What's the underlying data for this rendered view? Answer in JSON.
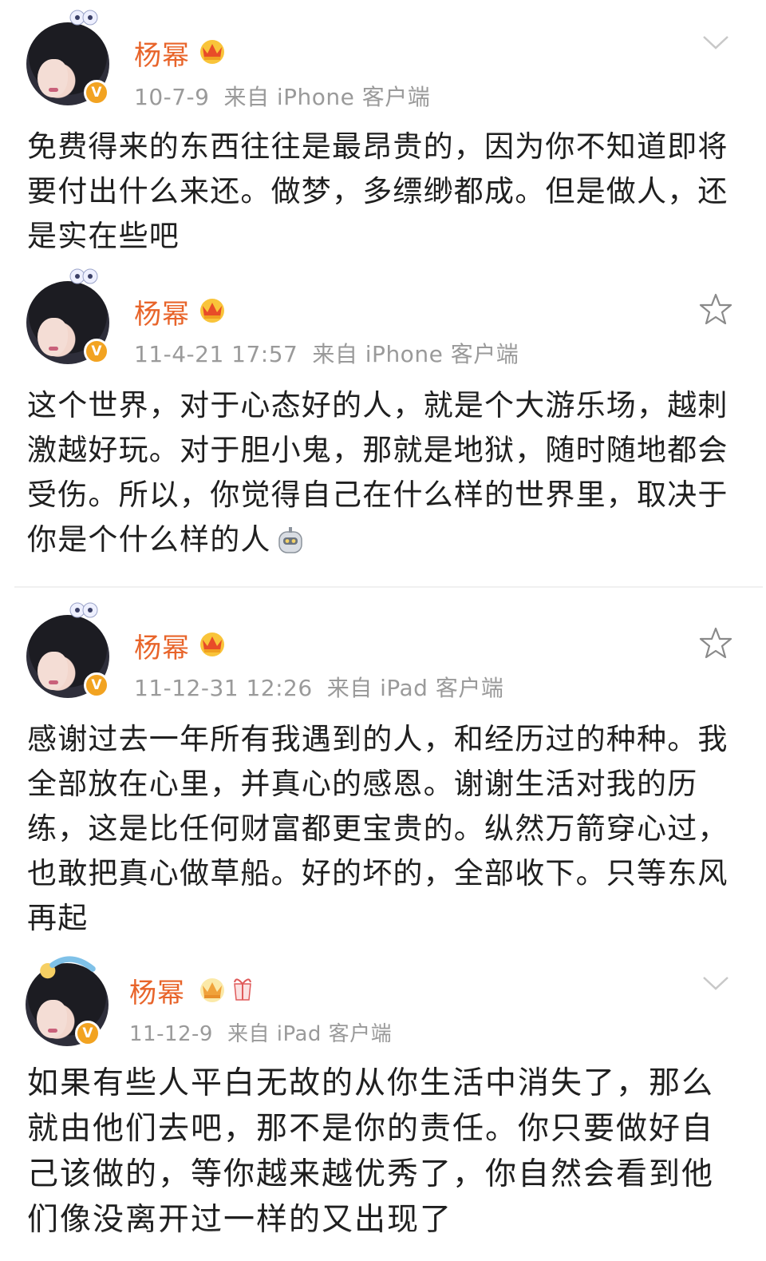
{
  "posts": [
    {
      "author": "杨幂",
      "time": "10-7-9",
      "source": "来自 iPhone 客户端",
      "text": "免费得来的东西往往是最昂贵的，因为你不知道即将要付出什么来还。做梦，多缥缈都成。但是做人，还是实在些吧",
      "action_icon": "chevron-down-icon"
    },
    {
      "author": "杨幂",
      "time": "11-4-21 17:57",
      "source": "来自 iPhone 客户端",
      "text": "这个世界，对于心态好的人，就是个大游乐场，越刺激越好玩。对于胆小鬼，那就是地狱，随时随地都会受伤。所以，你觉得自己在什么样的世界里，取决于你是个什么样的人",
      "action_icon": "star-icon"
    },
    {
      "author": "杨幂",
      "time": "11-12-31 12:26",
      "source": "来自 iPad 客户端",
      "text": "感谢过去一年所有我遇到的人，和经历过的种种。我全部放在心里，并真心的感恩。谢谢生活对我的历练，这是比任何财富都更宝贵的。纵然万箭穿心过，也敢把真心做草船。好的坏的，全部收下。只等东风再起",
      "action_icon": "star-icon"
    },
    {
      "author": "杨幂",
      "time": "11-12-9",
      "source": "来自 iPad 客户端",
      "text": "如果有些人平白无故的从你生活中消失了，那么就由他们去吧，那不是你的责任。你只要做好自己该做的，等你越来越优秀了，你自然会看到他们像没离开过一样的又出现了",
      "action_icon": "chevron-down-icon"
    }
  ],
  "verify_badge": "V",
  "colors": {
    "name": "#e8642a",
    "meta": "#9a9a9a",
    "text": "#1f1f1f",
    "badge": "#f2a321"
  }
}
